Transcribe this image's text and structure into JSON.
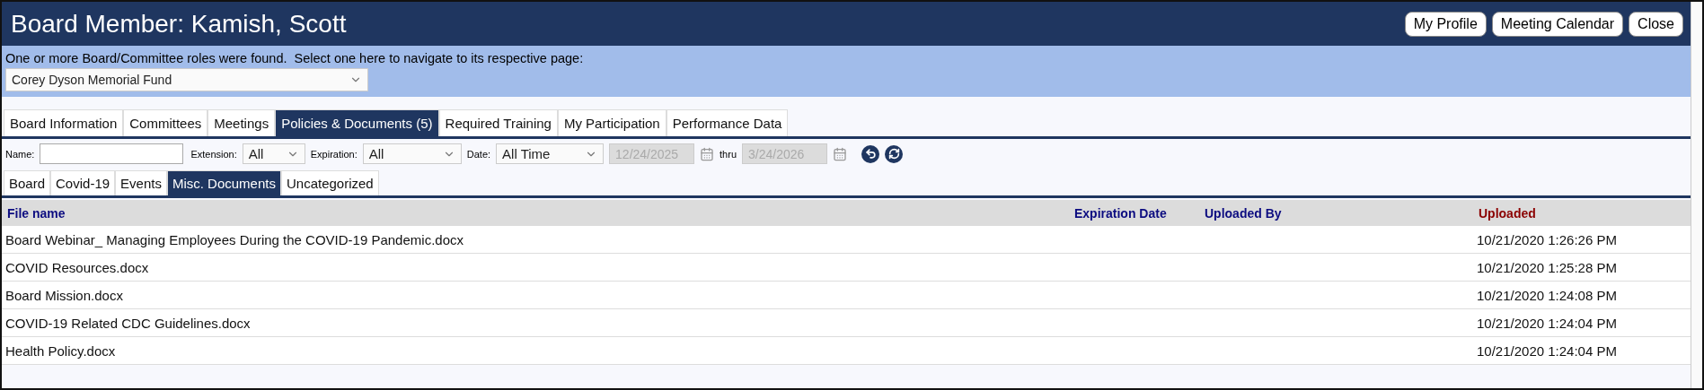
{
  "header": {
    "title": "Board Member: Kamish, Scott",
    "buttons": [
      "My Profile",
      "Meeting Calendar",
      "Close"
    ]
  },
  "roles": {
    "prompt": "One or more Board/Committee roles were found.  Select one here to navigate to its respective page:",
    "value": "Corey Dyson Memorial Fund"
  },
  "tabs": [
    {
      "label": "Board Information",
      "selected": false
    },
    {
      "label": "Committees",
      "selected": false
    },
    {
      "label": "Meetings",
      "selected": false
    },
    {
      "label": "Policies & Documents (5)",
      "selected": true
    },
    {
      "label": "Required Training",
      "selected": false
    },
    {
      "label": "My Participation",
      "selected": false
    },
    {
      "label": "Performance Data",
      "selected": false
    }
  ],
  "filters": {
    "name_label": "Name:",
    "extension_label": "Extension:",
    "extension_value": "All",
    "expiration_label": "Expiration:",
    "expiration_value": "All",
    "date_label": "Date:",
    "date_value": "All Time",
    "from_value": "12/24/2025",
    "from_disabled": true,
    "thru_label": "thru",
    "thru_value": "3/24/2026",
    "thru_disabled": true
  },
  "subtabs": [
    {
      "label": "Board",
      "selected": false
    },
    {
      "label": "Covid-19",
      "selected": false
    },
    {
      "label": "Events",
      "selected": false
    },
    {
      "label": "Misc. Documents",
      "selected": true
    },
    {
      "label": "Uncategorized",
      "selected": false
    }
  ],
  "table": {
    "columns": [
      {
        "label": "File name",
        "sorted": false
      },
      {
        "label": "Expiration Date",
        "sorted": false
      },
      {
        "label": "Uploaded By",
        "sorted": false
      },
      {
        "label": "Uploaded",
        "sorted": true
      }
    ],
    "rows": [
      [
        "Board Webinar_ Managing Employees During the COVID-19 Pandemic.docx",
        "10/21/2020 1:26:26 PM"
      ],
      [
        "COVID Resources.docx",
        "10/21/2020 1:25:28 PM"
      ],
      [
        "Board Mission.docx",
        "10/21/2020 1:24:08 PM"
      ],
      [
        "COVID-19 Related CDC Guidelines.docx",
        "10/21/2020 1:24:04 PM"
      ],
      [
        "Health Policy.docx",
        "10/21/2020 1:24:04 PM"
      ]
    ]
  }
}
